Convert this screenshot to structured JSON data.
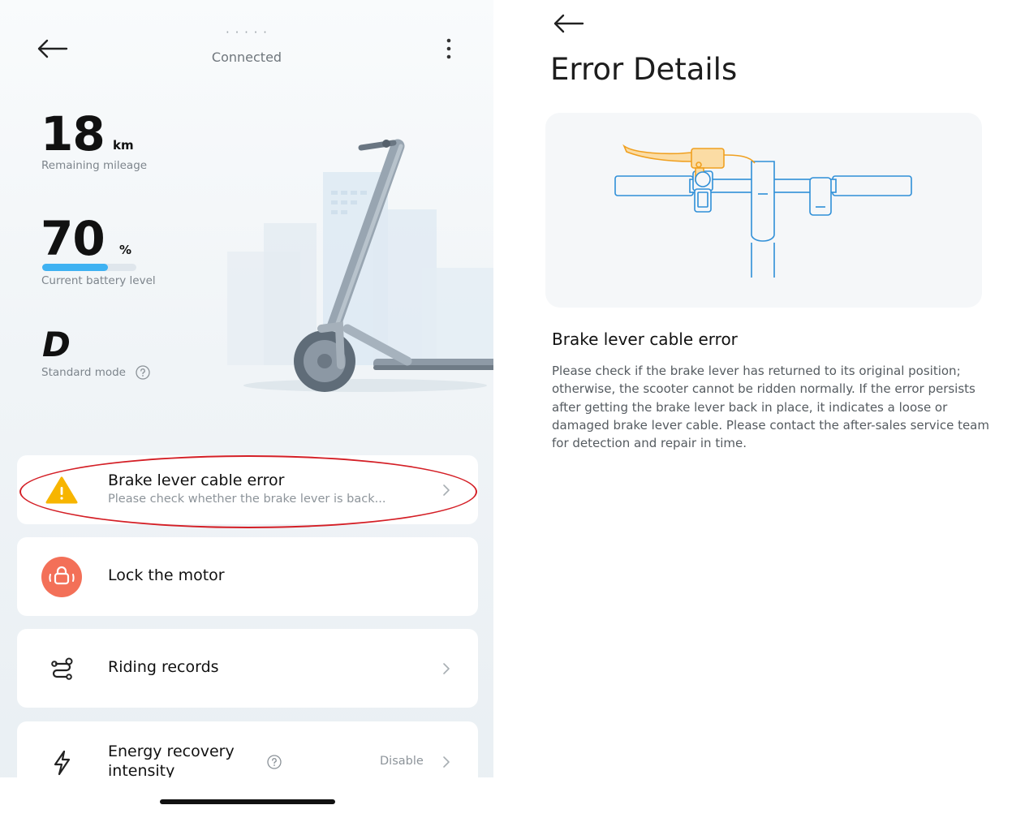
{
  "left_panel": {
    "header": {
      "device_name": "· · · · ·",
      "status": "Connected"
    },
    "mileage": {
      "value": "18",
      "unit": "km",
      "label": "Remaining mileage"
    },
    "battery": {
      "value": "70",
      "unit": "%",
      "label": "Current battery level",
      "level_fraction": 0.7,
      "bar_color": "#3fb2f2"
    },
    "mode": {
      "value": "D",
      "label": "Standard mode"
    },
    "cards": {
      "error": {
        "title": "Brake lever cable error",
        "subtitle": "Please check whether the brake lever is back...",
        "icon": "warning-icon",
        "icon_color": "#f7b500"
      },
      "lock": {
        "title": "Lock the motor",
        "icon": "lock-motor-icon",
        "icon_color": "#f37058"
      },
      "records": {
        "title": "Riding records",
        "icon": "route-icon"
      },
      "energy": {
        "title_line1": "Energy recovery",
        "title_line2": "intensity",
        "value": "Disable",
        "icon": "lightning-icon"
      }
    },
    "annotation_color": "#d41f26"
  },
  "right_panel": {
    "title": "Error Details",
    "error_title": "Brake lever cable error",
    "error_description": "Please check if the brake lever has returned to its original position; otherwise, the scooter cannot be ridden normally. If the error persists after getting the brake lever back in place, it indicates a loose or damaged brake lever cable. Please contact the after-sales service team for detection and repair in time.",
    "illustration": "handlebar-brake-lever-illustration",
    "highlight_color": "#f5a623"
  }
}
